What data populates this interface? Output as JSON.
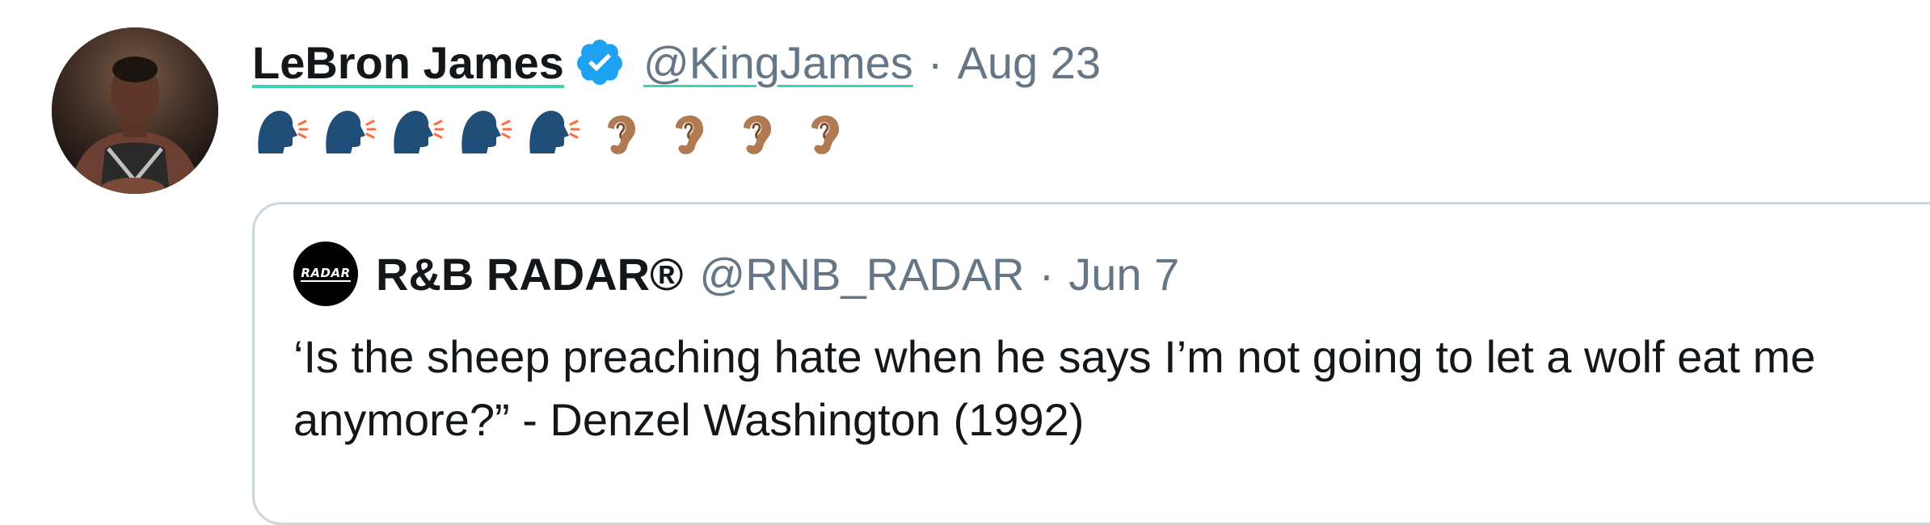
{
  "tweet": {
    "author_name": "LeBron James",
    "author_handle": "@KingJames",
    "separator": "·",
    "date": "Aug 23",
    "verified_icon": "verified-badge-icon",
    "emojis": [
      {
        "icon": "speaking-head-icon"
      },
      {
        "icon": "speaking-head-icon"
      },
      {
        "icon": "speaking-head-icon"
      },
      {
        "icon": "speaking-head-icon"
      },
      {
        "icon": "speaking-head-icon"
      },
      {
        "icon": "ear-icon"
      },
      {
        "icon": "ear-icon"
      },
      {
        "icon": "ear-icon"
      },
      {
        "icon": "ear-icon"
      }
    ]
  },
  "quoted": {
    "avatar_text": "RADAR",
    "author_name": "R&B RADAR®",
    "author_handle": "@RNB_RADAR",
    "separator": "·",
    "date": "Jun 7",
    "text": "‘Is the sheep preaching hate when he says I’m not going to let a wolf eat me anymore?” - Denzel Washington (1992)"
  },
  "colors": {
    "text": "#14171a",
    "secondary": "#657786",
    "verified": "#1da1f2",
    "card_border": "#ccd6dd",
    "underline": "#3dd3b6"
  }
}
